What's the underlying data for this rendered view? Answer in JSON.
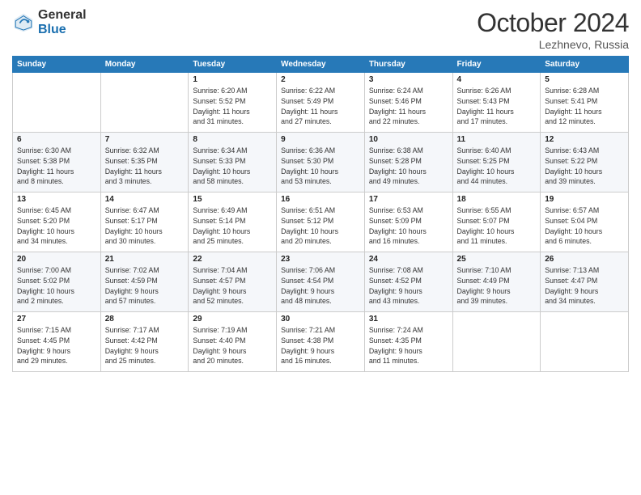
{
  "header": {
    "logo_general": "General",
    "logo_blue": "Blue",
    "month_title": "October 2024",
    "location": "Lezhnevo, Russia"
  },
  "weekdays": [
    "Sunday",
    "Monday",
    "Tuesday",
    "Wednesday",
    "Thursday",
    "Friday",
    "Saturday"
  ],
  "weeks": [
    [
      {
        "day": "",
        "info": ""
      },
      {
        "day": "",
        "info": ""
      },
      {
        "day": "1",
        "info": "Sunrise: 6:20 AM\nSunset: 5:52 PM\nDaylight: 11 hours\nand 31 minutes."
      },
      {
        "day": "2",
        "info": "Sunrise: 6:22 AM\nSunset: 5:49 PM\nDaylight: 11 hours\nand 27 minutes."
      },
      {
        "day": "3",
        "info": "Sunrise: 6:24 AM\nSunset: 5:46 PM\nDaylight: 11 hours\nand 22 minutes."
      },
      {
        "day": "4",
        "info": "Sunrise: 6:26 AM\nSunset: 5:43 PM\nDaylight: 11 hours\nand 17 minutes."
      },
      {
        "day": "5",
        "info": "Sunrise: 6:28 AM\nSunset: 5:41 PM\nDaylight: 11 hours\nand 12 minutes."
      }
    ],
    [
      {
        "day": "6",
        "info": "Sunrise: 6:30 AM\nSunset: 5:38 PM\nDaylight: 11 hours\nand 8 minutes."
      },
      {
        "day": "7",
        "info": "Sunrise: 6:32 AM\nSunset: 5:35 PM\nDaylight: 11 hours\nand 3 minutes."
      },
      {
        "day": "8",
        "info": "Sunrise: 6:34 AM\nSunset: 5:33 PM\nDaylight: 10 hours\nand 58 minutes."
      },
      {
        "day": "9",
        "info": "Sunrise: 6:36 AM\nSunset: 5:30 PM\nDaylight: 10 hours\nand 53 minutes."
      },
      {
        "day": "10",
        "info": "Sunrise: 6:38 AM\nSunset: 5:28 PM\nDaylight: 10 hours\nand 49 minutes."
      },
      {
        "day": "11",
        "info": "Sunrise: 6:40 AM\nSunset: 5:25 PM\nDaylight: 10 hours\nand 44 minutes."
      },
      {
        "day": "12",
        "info": "Sunrise: 6:43 AM\nSunset: 5:22 PM\nDaylight: 10 hours\nand 39 minutes."
      }
    ],
    [
      {
        "day": "13",
        "info": "Sunrise: 6:45 AM\nSunset: 5:20 PM\nDaylight: 10 hours\nand 34 minutes."
      },
      {
        "day": "14",
        "info": "Sunrise: 6:47 AM\nSunset: 5:17 PM\nDaylight: 10 hours\nand 30 minutes."
      },
      {
        "day": "15",
        "info": "Sunrise: 6:49 AM\nSunset: 5:14 PM\nDaylight: 10 hours\nand 25 minutes."
      },
      {
        "day": "16",
        "info": "Sunrise: 6:51 AM\nSunset: 5:12 PM\nDaylight: 10 hours\nand 20 minutes."
      },
      {
        "day": "17",
        "info": "Sunrise: 6:53 AM\nSunset: 5:09 PM\nDaylight: 10 hours\nand 16 minutes."
      },
      {
        "day": "18",
        "info": "Sunrise: 6:55 AM\nSunset: 5:07 PM\nDaylight: 10 hours\nand 11 minutes."
      },
      {
        "day": "19",
        "info": "Sunrise: 6:57 AM\nSunset: 5:04 PM\nDaylight: 10 hours\nand 6 minutes."
      }
    ],
    [
      {
        "day": "20",
        "info": "Sunrise: 7:00 AM\nSunset: 5:02 PM\nDaylight: 10 hours\nand 2 minutes."
      },
      {
        "day": "21",
        "info": "Sunrise: 7:02 AM\nSunset: 4:59 PM\nDaylight: 9 hours\nand 57 minutes."
      },
      {
        "day": "22",
        "info": "Sunrise: 7:04 AM\nSunset: 4:57 PM\nDaylight: 9 hours\nand 52 minutes."
      },
      {
        "day": "23",
        "info": "Sunrise: 7:06 AM\nSunset: 4:54 PM\nDaylight: 9 hours\nand 48 minutes."
      },
      {
        "day": "24",
        "info": "Sunrise: 7:08 AM\nSunset: 4:52 PM\nDaylight: 9 hours\nand 43 minutes."
      },
      {
        "day": "25",
        "info": "Sunrise: 7:10 AM\nSunset: 4:49 PM\nDaylight: 9 hours\nand 39 minutes."
      },
      {
        "day": "26",
        "info": "Sunrise: 7:13 AM\nSunset: 4:47 PM\nDaylight: 9 hours\nand 34 minutes."
      }
    ],
    [
      {
        "day": "27",
        "info": "Sunrise: 7:15 AM\nSunset: 4:45 PM\nDaylight: 9 hours\nand 29 minutes."
      },
      {
        "day": "28",
        "info": "Sunrise: 7:17 AM\nSunset: 4:42 PM\nDaylight: 9 hours\nand 25 minutes."
      },
      {
        "day": "29",
        "info": "Sunrise: 7:19 AM\nSunset: 4:40 PM\nDaylight: 9 hours\nand 20 minutes."
      },
      {
        "day": "30",
        "info": "Sunrise: 7:21 AM\nSunset: 4:38 PM\nDaylight: 9 hours\nand 16 minutes."
      },
      {
        "day": "31",
        "info": "Sunrise: 7:24 AM\nSunset: 4:35 PM\nDaylight: 9 hours\nand 11 minutes."
      },
      {
        "day": "",
        "info": ""
      },
      {
        "day": "",
        "info": ""
      }
    ]
  ]
}
